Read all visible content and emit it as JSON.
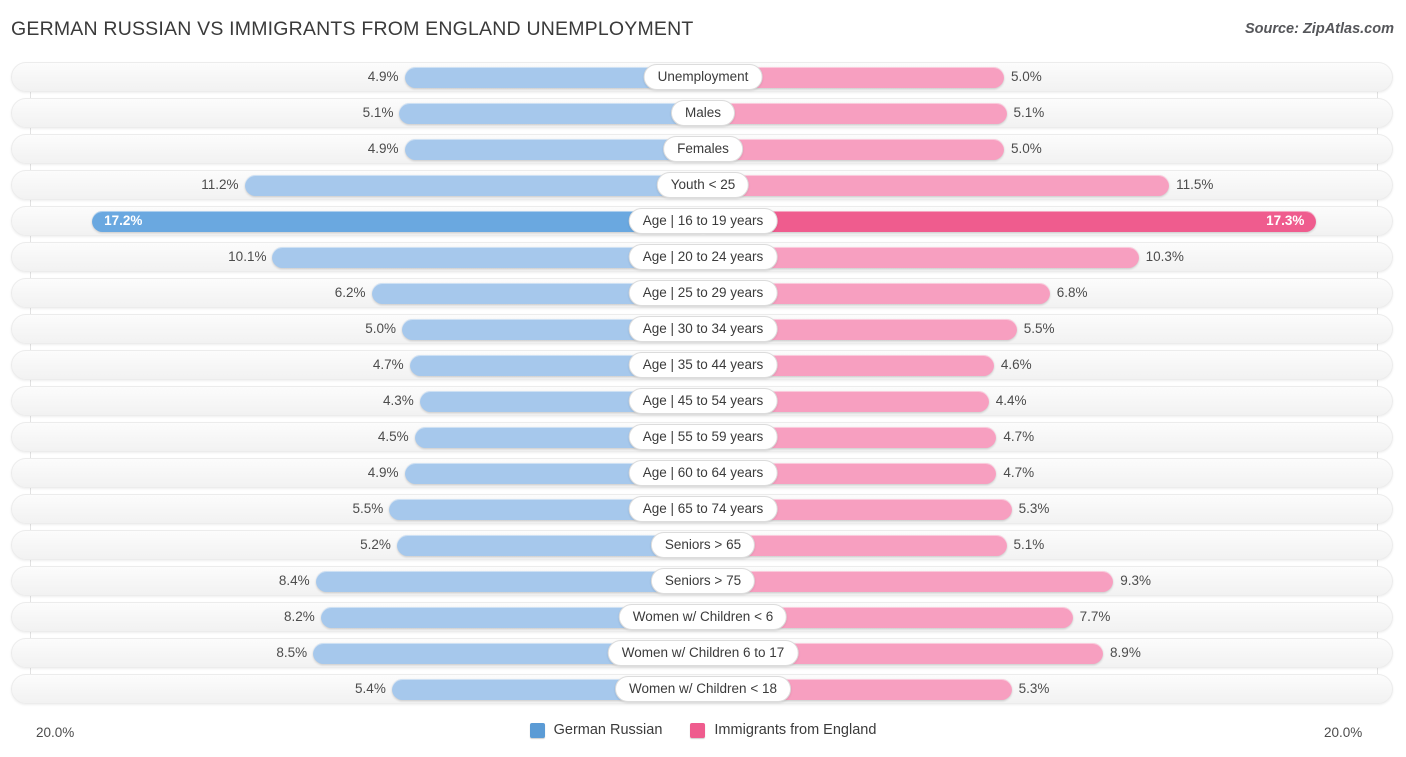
{
  "header": {
    "title": "GERMAN RUSSIAN VS IMMIGRANTS FROM ENGLAND UNEMPLOYMENT",
    "source": "Source: ZipAtlas.com"
  },
  "axis": {
    "left_label": "20.0%",
    "right_label": "20.0%",
    "max": 20.0
  },
  "legend": {
    "items": [
      {
        "label": "German Russian",
        "color": "#5b9bd5"
      },
      {
        "label": "Immigrants from England",
        "color": "#ef5c8e"
      }
    ]
  },
  "colors": {
    "left_light": "#a6c8ec",
    "left_dark": "#6aa8e0",
    "right_light": "#f79fc0",
    "right_dark": "#ef5c8e",
    "track": "#f7f7f7",
    "gridline": "#e2e2e2",
    "text": "#4c4c4c"
  },
  "chart_data": {
    "type": "bar",
    "title": "GERMAN RUSSIAN VS IMMIGRANTS FROM ENGLAND UNEMPLOYMENT",
    "subtitle": "Source: ZipAtlas.com",
    "orientation": "horizontal-diverging",
    "xlabel": "",
    "ylabel": "",
    "xlim": [
      20.0,
      20.0
    ],
    "grid": true,
    "legend_position": "bottom-center",
    "categories": [
      "Unemployment",
      "Males",
      "Females",
      "Youth < 25",
      "Age | 16 to 19 years",
      "Age | 20 to 24 years",
      "Age | 25 to 29 years",
      "Age | 30 to 34 years",
      "Age | 35 to 44 years",
      "Age | 45 to 54 years",
      "Age | 55 to 59 years",
      "Age | 60 to 64 years",
      "Age | 65 to 74 years",
      "Seniors > 65",
      "Seniors > 75",
      "Women w/ Children < 6",
      "Women w/ Children 6 to 17",
      "Women w/ Children < 18"
    ],
    "series": [
      {
        "name": "German Russian",
        "side": "left",
        "values": [
          4.9,
          5.1,
          4.9,
          11.2,
          17.2,
          10.1,
          6.2,
          5.0,
          4.7,
          4.3,
          4.5,
          4.9,
          5.5,
          5.2,
          8.4,
          8.2,
          8.5,
          5.4
        ],
        "labels": [
          "4.9%",
          "5.1%",
          "4.9%",
          "11.2%",
          "17.2%",
          "10.1%",
          "6.2%",
          "5.0%",
          "4.7%",
          "4.3%",
          "4.5%",
          "4.9%",
          "5.5%",
          "5.2%",
          "8.4%",
          "8.2%",
          "8.5%",
          "5.4%"
        ]
      },
      {
        "name": "Immigrants from England",
        "side": "right",
        "values": [
          5.0,
          5.1,
          5.0,
          11.5,
          17.3,
          10.3,
          6.8,
          5.5,
          4.6,
          4.4,
          4.7,
          4.7,
          5.3,
          5.1,
          9.3,
          7.7,
          8.9,
          5.3
        ],
        "labels": [
          "5.0%",
          "5.1%",
          "5.0%",
          "11.5%",
          "17.3%",
          "10.3%",
          "6.8%",
          "5.5%",
          "4.6%",
          "4.4%",
          "4.7%",
          "4.7%",
          "5.3%",
          "5.1%",
          "9.3%",
          "7.7%",
          "8.9%",
          "5.3%"
        ]
      }
    ],
    "highlighted_row": "Age | 16 to 19 years"
  }
}
